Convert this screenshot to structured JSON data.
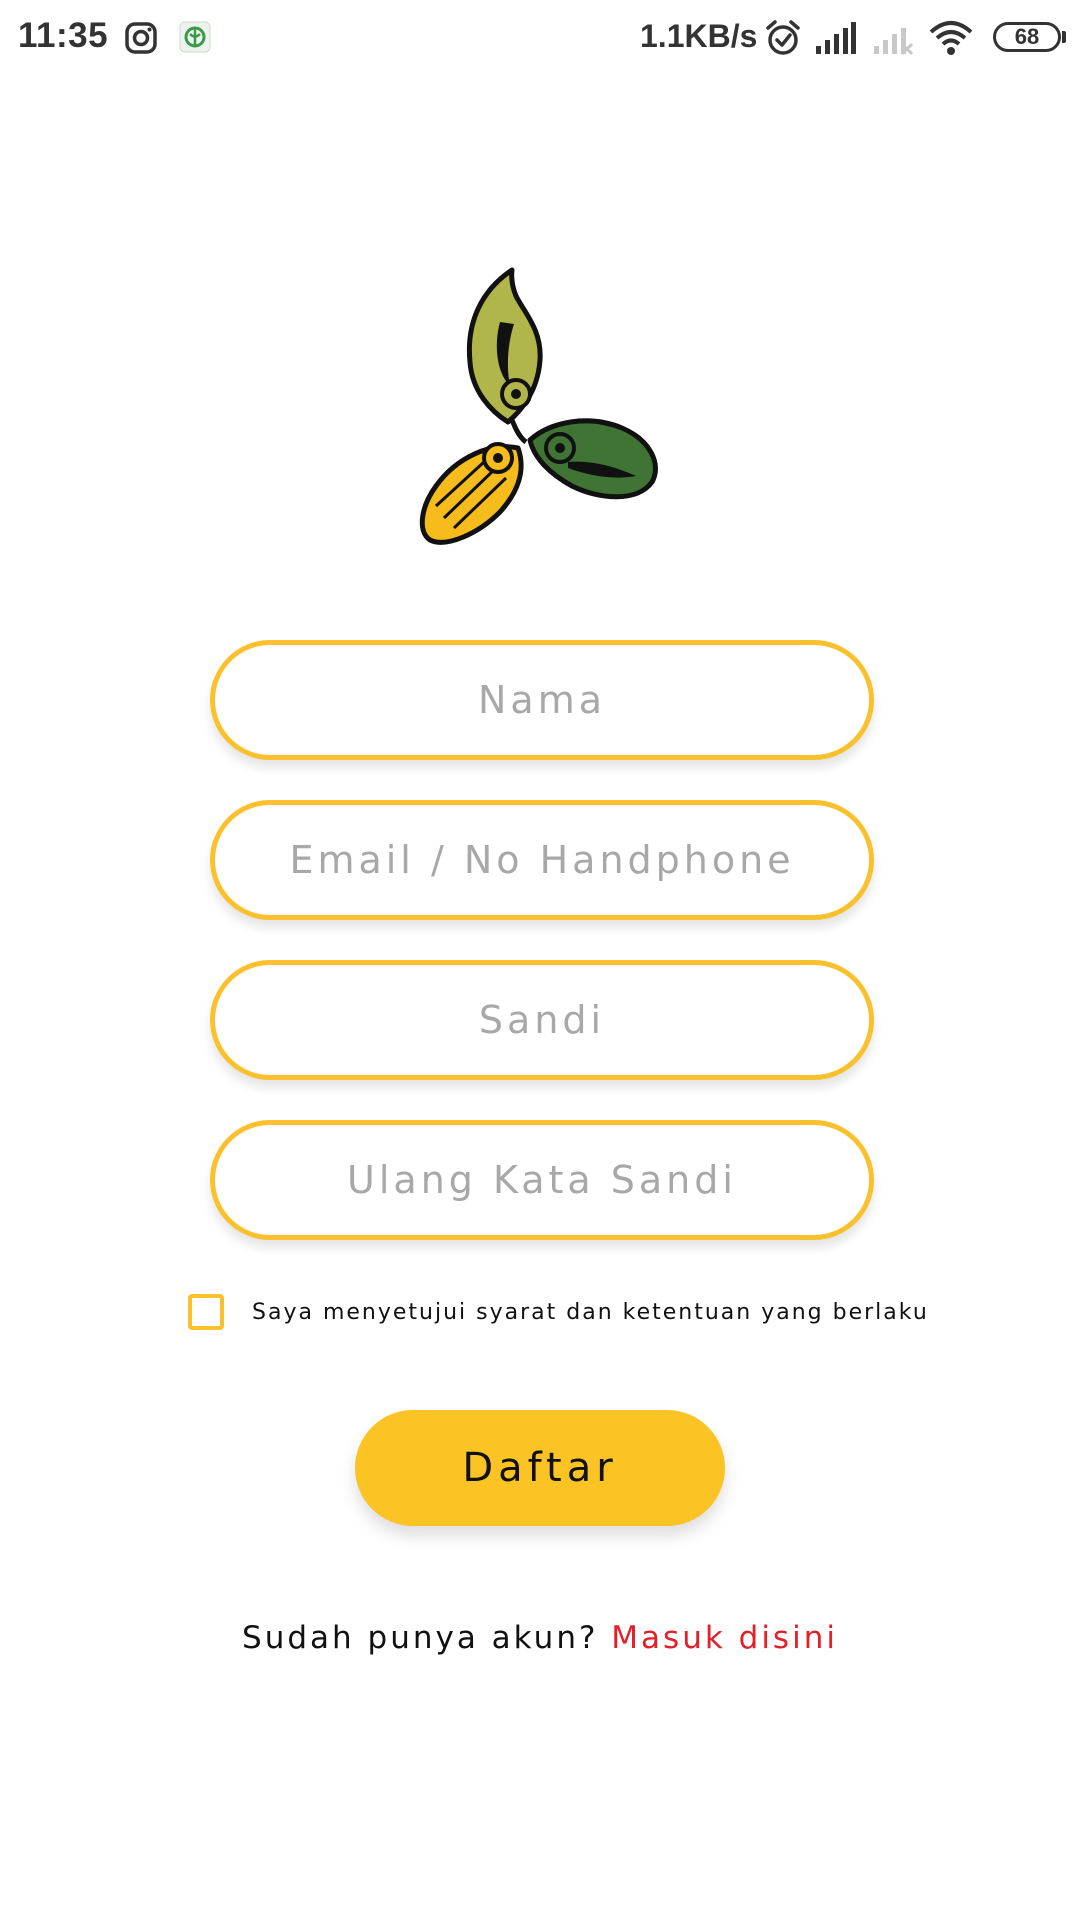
{
  "status_bar": {
    "time": "11:35",
    "speed": "1.1KB/s",
    "battery": "68",
    "icons": [
      "instagram-icon",
      "app-notification-icon",
      "alarm-icon",
      "signal-icon",
      "signal-empty-icon",
      "wifi-icon",
      "battery-icon"
    ]
  },
  "logo": {
    "icon": "leaf-trefoil-logo"
  },
  "form": {
    "nama_placeholder": "Nama",
    "email_placeholder": "Email / No Handphone",
    "sandi_placeholder": "Sandi",
    "ulang_placeholder": "Ulang Kata Sandi",
    "terms_label": "Saya menyetujui syarat dan ketentuan yang berlaku",
    "terms_checked": false,
    "submit_label": "Daftar"
  },
  "footer": {
    "prompt": "Sudah punya akun?",
    "link": "Masuk disini"
  },
  "colors": {
    "accent": "#fbc02d",
    "button": "#fbc424",
    "link": "#e3202a",
    "placeholder": "#a8a8a8"
  }
}
